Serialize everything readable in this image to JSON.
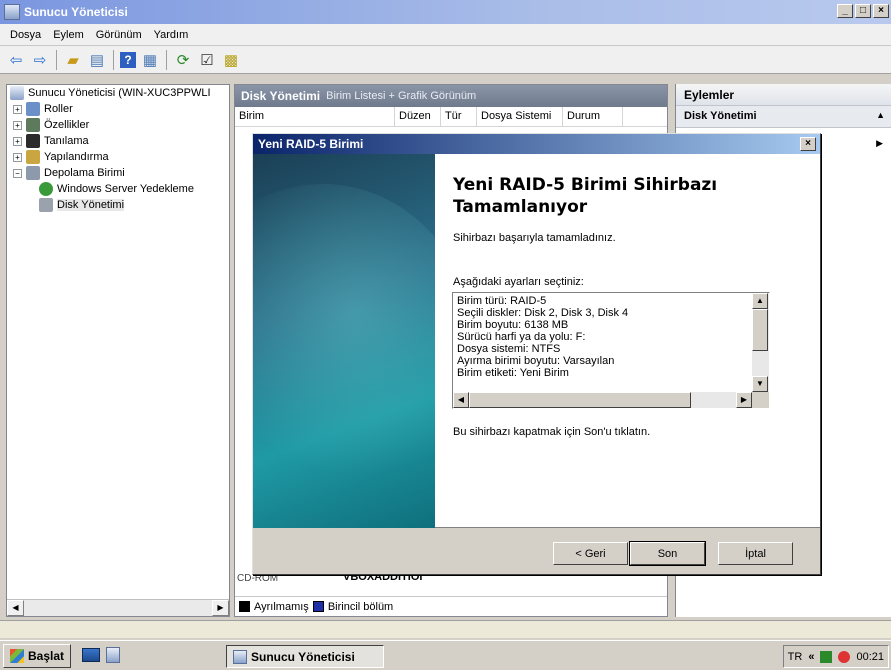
{
  "window": {
    "title": "Sunucu Yöneticisi"
  },
  "menu": [
    "Dosya",
    "Eylem",
    "Görünüm",
    "Yardım"
  ],
  "tree": {
    "root": "Sunucu Yöneticisi (WIN-XUC3PPWLI",
    "items": [
      "Roller",
      "Özellikler",
      "Tanılama",
      "Yapılandırma",
      "Depolama Birimi",
      "Windows Server Yedekleme",
      "Disk Yönetimi"
    ]
  },
  "center": {
    "title": "Disk Yönetimi",
    "subtitle": "Birim Listesi + Grafik Görünüm",
    "columns": [
      "Birim",
      "Düzen",
      "Tür",
      "Dosya Sistemi",
      "Durum"
    ],
    "behind_fragment": "VBOXADDITIOI",
    "behind_fragment2": "CD-ROM",
    "legend": [
      "Ayrılmamış",
      "Birincil bölüm"
    ],
    "colors": {
      "unallocated": "#000000",
      "primary": "#1f2fa8"
    }
  },
  "actions": {
    "header": "Eylemler",
    "section": "Disk Yönetimi"
  },
  "dialog": {
    "title": "Yeni RAID-5 Birimi",
    "heading_line1": "Yeni RAID-5 Birimi Sihirbazı",
    "heading_line2": "Tamamlanıyor",
    "success_text": "Sihirbazı başarıyla tamamladınız.",
    "settings_label": "Aşağıdaki ayarları seçtiniz:",
    "summary_lines": [
      "Birim türü: RAID-5",
      "Seçili diskler: Disk 2, Disk 3, Disk 4",
      "Birim boyutu: 6138 MB",
      "Sürücü harfi ya da yolu: F:",
      "Dosya sistemi: NTFS",
      "Ayırma birimi boyutu: Varsayılan",
      "Birim etiketi: Yeni Birim"
    ],
    "close_text": "Bu sihirbazı kapatmak için Son'u tıklatın.",
    "buttons": {
      "back": "< Geri",
      "finish": "Son",
      "cancel": "İptal"
    }
  },
  "taskbar": {
    "start": "Başlat",
    "task": "Sunucu Yöneticisi",
    "lang": "TR",
    "chevron": "«",
    "time": "00:21"
  }
}
